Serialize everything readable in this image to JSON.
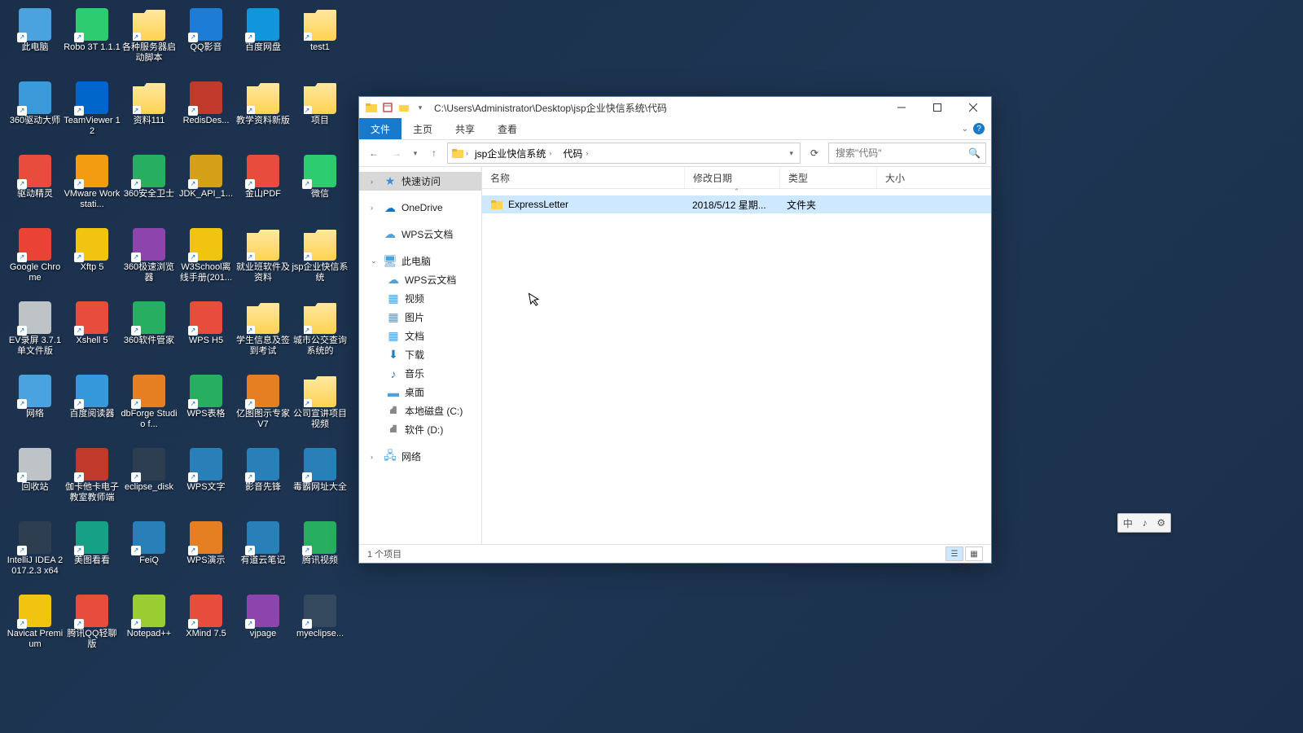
{
  "desktop_icons": [
    {
      "label": "此电脑",
      "color": "#4aa3df"
    },
    {
      "label": "Robo 3T 1.1.1",
      "color": "#2ecc71"
    },
    {
      "label": "各种服务器启动脚本",
      "color": "#ffd250",
      "folder": true
    },
    {
      "label": "QQ影音",
      "color": "#1c7cd6"
    },
    {
      "label": "百度网盘",
      "color": "#1296db"
    },
    {
      "label": "test1",
      "color": "#ffd250",
      "folder": true
    },
    {
      "label": "360驱动大师",
      "color": "#3a9ad9"
    },
    {
      "label": "TeamViewer 12",
      "color": "#0066cc"
    },
    {
      "label": "资料111",
      "color": "#ffd250",
      "folder": true
    },
    {
      "label": "RedisDes...",
      "color": "#c0392b"
    },
    {
      "label": "教学资料新版",
      "color": "#ffd250",
      "folder": true
    },
    {
      "label": "项目",
      "color": "#ffd250",
      "folder": true
    },
    {
      "label": "驱动精灵",
      "color": "#e74c3c"
    },
    {
      "label": "VMware Workstati...",
      "color": "#f39c12"
    },
    {
      "label": "360安全卫士",
      "color": "#27ae60"
    },
    {
      "label": "JDK_API_1...",
      "color": "#d4a017"
    },
    {
      "label": "金山PDF",
      "color": "#e74c3c"
    },
    {
      "label": "微信",
      "color": "#2ecc71"
    },
    {
      "label": "Google Chrome",
      "color": "#ea4335"
    },
    {
      "label": "Xftp 5",
      "color": "#f1c40f"
    },
    {
      "label": "360极速浏览器",
      "color": "#8e44ad"
    },
    {
      "label": "W3School离线手册(201...",
      "color": "#f1c40f"
    },
    {
      "label": "就业班软件及资料",
      "color": "#ffd250",
      "folder": true
    },
    {
      "label": "jsp企业快信系统",
      "color": "#ffd250",
      "folder": true
    },
    {
      "label": "EV录屏 3.7.1 单文件版",
      "color": "#bdc3c7"
    },
    {
      "label": "Xshell 5",
      "color": "#e74c3c"
    },
    {
      "label": "360软件管家",
      "color": "#27ae60"
    },
    {
      "label": "WPS H5",
      "color": "#e74c3c"
    },
    {
      "label": "学生信息及签到考试",
      "color": "#ffd250",
      "folder": true
    },
    {
      "label": "城市公交查询系统的",
      "color": "#ffd250",
      "folder": true
    },
    {
      "label": "网络",
      "color": "#4aa3df"
    },
    {
      "label": "百度阅读器",
      "color": "#3498db"
    },
    {
      "label": "dbForge Studio f...",
      "color": "#e67e22"
    },
    {
      "label": "WPS表格",
      "color": "#27ae60"
    },
    {
      "label": "亿图图示专家V7",
      "color": "#e67e22"
    },
    {
      "label": "公司宣讲项目视频",
      "color": "#ffd250",
      "folder": true
    },
    {
      "label": "回收站",
      "color": "#bdc3c7"
    },
    {
      "label": "伽卡他卡电子教室教师端",
      "color": "#c0392b"
    },
    {
      "label": "eclipse_disk",
      "color": "#2c3e50"
    },
    {
      "label": "WPS文字",
      "color": "#2980b9"
    },
    {
      "label": "影音先锋",
      "color": "#2980b9"
    },
    {
      "label": "毒霸网址大全",
      "color": "#2980b9"
    },
    {
      "label": "IntelliJ IDEA 2017.2.3 x64",
      "color": "#2c3e50"
    },
    {
      "label": "美图看看",
      "color": "#16a085"
    },
    {
      "label": "FeiQ",
      "color": "#2980b9"
    },
    {
      "label": "WPS演示",
      "color": "#e67e22"
    },
    {
      "label": "有道云笔记",
      "color": "#2980b9"
    },
    {
      "label": "腾讯视频",
      "color": "#27ae60"
    },
    {
      "label": "Navicat Premium",
      "color": "#f1c40f"
    },
    {
      "label": "腾讯QQ轻聊版",
      "color": "#e74c3c"
    },
    {
      "label": "Notepad++",
      "color": "#9acd32"
    },
    {
      "label": "XMind 7.5",
      "color": "#e74c3c"
    },
    {
      "label": "vjpage",
      "color": "#8e44ad"
    },
    {
      "label": "myeclipse...",
      "color": "#34495e"
    }
  ],
  "explorer": {
    "title_path": "C:\\Users\\Administrator\\Desktop\\jsp企业快信系统\\代码",
    "ribbon": {
      "file": "文件",
      "home": "主页",
      "share": "共享",
      "view": "查看"
    },
    "breadcrumbs": [
      "jsp企业快信系统",
      "代码"
    ],
    "search_placeholder": "搜索\"代码\"",
    "nav": {
      "quick": "快速访问",
      "onedrive": "OneDrive",
      "wps": "WPS云文档",
      "thispc": "此电脑",
      "wps2": "WPS云文档",
      "video": "视频",
      "pic": "图片",
      "doc": "文档",
      "dl": "下载",
      "music": "音乐",
      "desktop": "桌面",
      "cdrive": "本地磁盘 (C:)",
      "ddrive": "软件 (D:)",
      "network": "网络"
    },
    "columns": {
      "name": "名称",
      "date": "修改日期",
      "type": "类型",
      "size": "大小"
    },
    "rows": [
      {
        "name": "ExpressLetter",
        "date": "2018/5/12 星期...",
        "type": "文件夹",
        "size": ""
      }
    ],
    "status": "1 个项目"
  },
  "ime": {
    "lang": "中"
  }
}
